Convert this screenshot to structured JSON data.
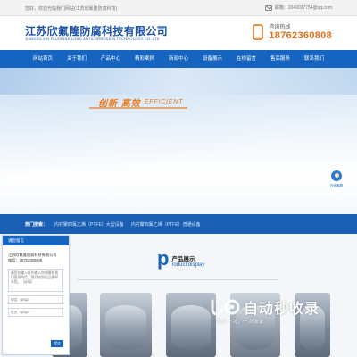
{
  "topbar": {
    "welcome": "您好，欢迎光临我们网站(江苏欣氟隆防腐科技)",
    "email_label": "邮箱：2049037754@qq.com"
  },
  "header": {
    "company_cn": "江苏欣氟隆防腐科技有限公司",
    "company_en": "JIANGSU XIN FLUORINE LONG ANTICORROSION TECHNOLOGY CO.,LTD",
    "hotline_label": "咨询热线",
    "hotline_number": "18762360808"
  },
  "nav": {
    "items": [
      "网站首页",
      "关于我们",
      "产品中心",
      "精彩案例",
      "新闻中心",
      "设备展示",
      "在线留言",
      "售后服务",
      "联系我们"
    ]
  },
  "banner": {
    "slogan_cn": "创新 高效",
    "slogan_en": "EFFICIENT"
  },
  "float_service": {
    "label": "在线客服"
  },
  "hotbar": {
    "title": "热门搜索：",
    "links": [
      "内衬聚四氟乙烯（PTFE）大型设备",
      "内衬聚四氟乙烯（PTFE）普通设备"
    ]
  },
  "products": {
    "letter": "p",
    "title_cn": "产品展示",
    "title_en": "roduct display"
  },
  "message": {
    "header": "请您留言",
    "company": "江苏欣氟隆防腐科技有限公司",
    "phone": "电话：18762360808",
    "textarea_placeholder": "请您在输入框内输入你想要给我们要说的话，我们收到后立即联系您。（必填）",
    "phone_placeholder": "电话（必填）",
    "name_placeholder": "姓名（必填）",
    "submit": "提交"
  },
  "watermark": {
    "text": "自动秒收录",
    "sub": "提交一次，一次收录"
  },
  "colors": {
    "brand_blue": "#1565c0",
    "accent_orange": "#e0701c"
  }
}
